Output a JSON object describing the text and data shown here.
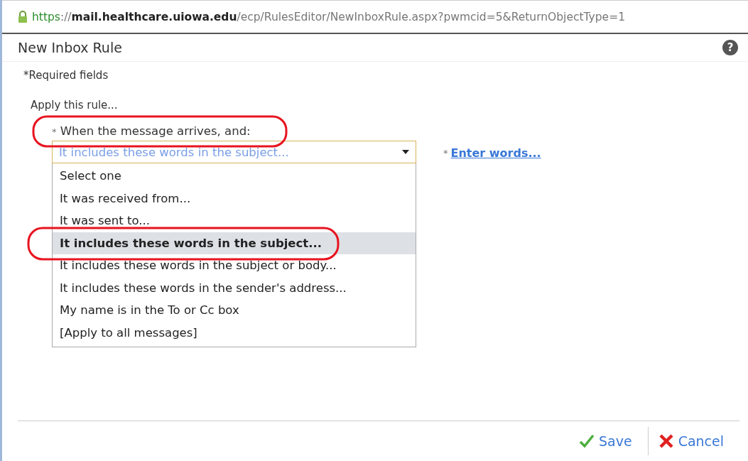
{
  "address_bar": {
    "secure": true,
    "scheme": "https",
    "separator": "://",
    "host": "mail.healthcare.uiowa.edu",
    "path": "/ecp/RulesEditor/NewInboxRule.aspx?pwmcid=5&ReturnObjectType=1"
  },
  "dialog": {
    "title": "New Inbox Rule",
    "help": "?"
  },
  "required_note": "*Required fields",
  "section_label": "Apply this rule...",
  "condition": {
    "required_mark": "*",
    "label": "When the message arrives, and:",
    "circled": true,
    "value": "It includes these words in the subject...",
    "expanded": true
  },
  "options": [
    {
      "label": "Select one",
      "selected": false,
      "circled": false
    },
    {
      "label": "It was received from...",
      "selected": false,
      "circled": false
    },
    {
      "label": "It was sent to...",
      "selected": false,
      "circled": false
    },
    {
      "label": "It includes these words in the subject...",
      "selected": true,
      "circled": true
    },
    {
      "label": "It includes these words in the subject or body...",
      "selected": false,
      "circled": false
    },
    {
      "label": "It includes these words in the sender's address...",
      "selected": false,
      "circled": false
    },
    {
      "label": "My name is in the To or Cc box",
      "selected": false,
      "circled": false
    },
    {
      "label": "[Apply to all messages]",
      "selected": false,
      "circled": false
    }
  ],
  "value_link": {
    "required_mark": "*",
    "label": "Enter words..."
  },
  "buttons": [
    {
      "kind": "save",
      "label": "Save"
    },
    {
      "kind": "cancel",
      "label": "Cancel"
    }
  ]
}
